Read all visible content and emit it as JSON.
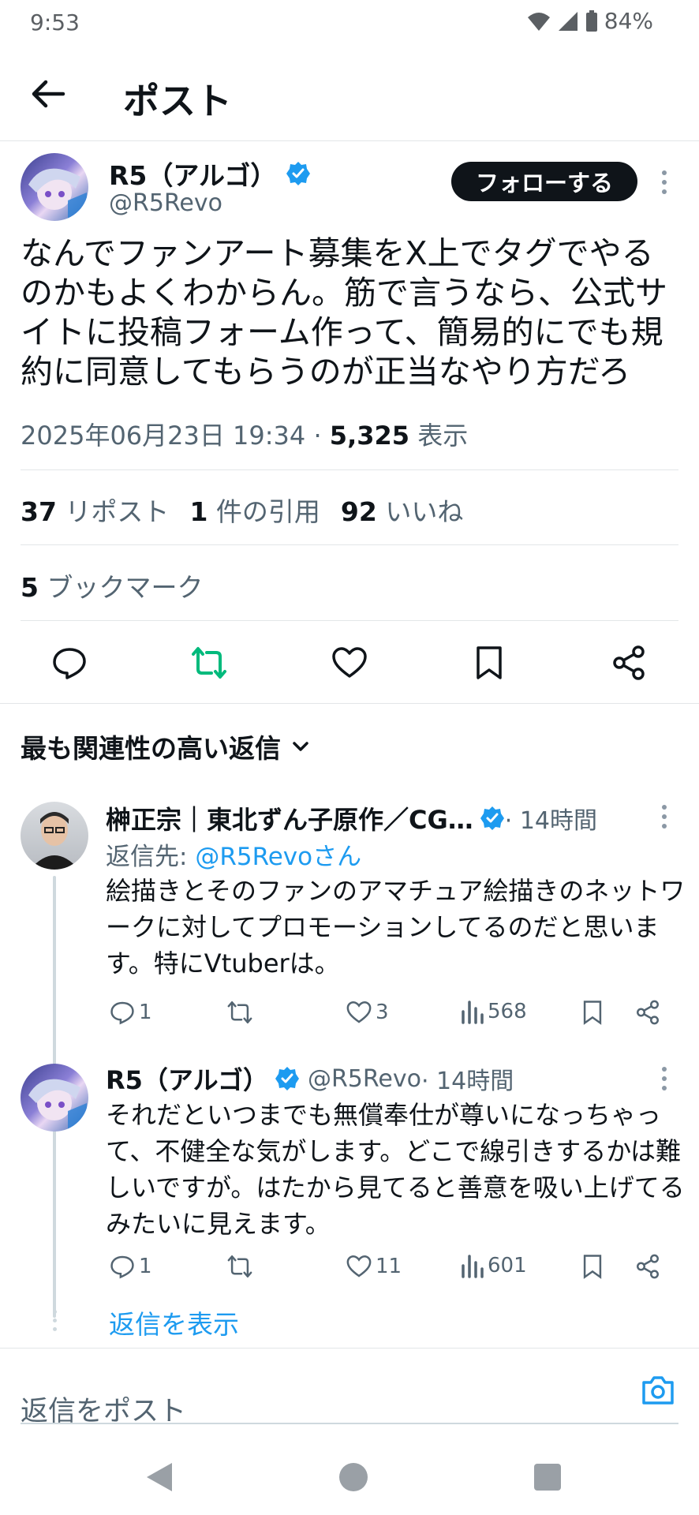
{
  "status": {
    "time": "9:53",
    "battery": "84%"
  },
  "header": {
    "title": "ポスト"
  },
  "post": {
    "author_name": "R5（アルゴ）",
    "author_handle": "@R5Revo",
    "follow_label": "フォローする",
    "text": "なんでファンアート募集をX上でタグでやるのかもよくわからん。筋で言うなら、公式サイトに投稿フォーム作って、簡易的にでも規約に同意してもらうのが正当なやり方だろ",
    "datetime": "2025年06月23日 19:34 · ",
    "views_count": "5,325",
    "views_label": " 表示",
    "reposts_count": "37",
    "reposts_label": " リポスト",
    "quotes_count": "1",
    "quotes_label": " 件の引用",
    "likes_count": "92",
    "likes_label": " いいね",
    "bookmarks_count": "5",
    "bookmarks_label": " ブックマーク"
  },
  "sort": {
    "label": "最も関連性の高い返信"
  },
  "replies": [
    {
      "name": "榊正宗｜東北ずん子原作／CG…",
      "time": " · 14時間",
      "reply_to_label": "返信先: ",
      "reply_to_handle": "@R5Revoさん",
      "text": "絵描きとそのファンのアマチュア絵描きのネットワークに対してプロモーションしてるのだと思います。特にVtuberは。",
      "replies": "1",
      "likes": "3",
      "views": "568"
    },
    {
      "name": "R5（アルゴ）",
      "handle": "@R5Revo",
      "time": " · 14時間",
      "text": "それだといつまでも無償奉仕が尊いになっちゃって、不健全な気がします。どこで線引きするかは難しいですが。はたから見てると善意を吸い上げてるみたいに見えます。",
      "replies": "1",
      "likes": "11",
      "views": "601"
    }
  ],
  "show_replies": "返信を表示",
  "compose": {
    "placeholder": "返信をポスト"
  },
  "colors": {
    "accent": "#1d9bf0",
    "repost_active": "#00ba7c",
    "text": "#0f1419",
    "muted": "#536471"
  }
}
